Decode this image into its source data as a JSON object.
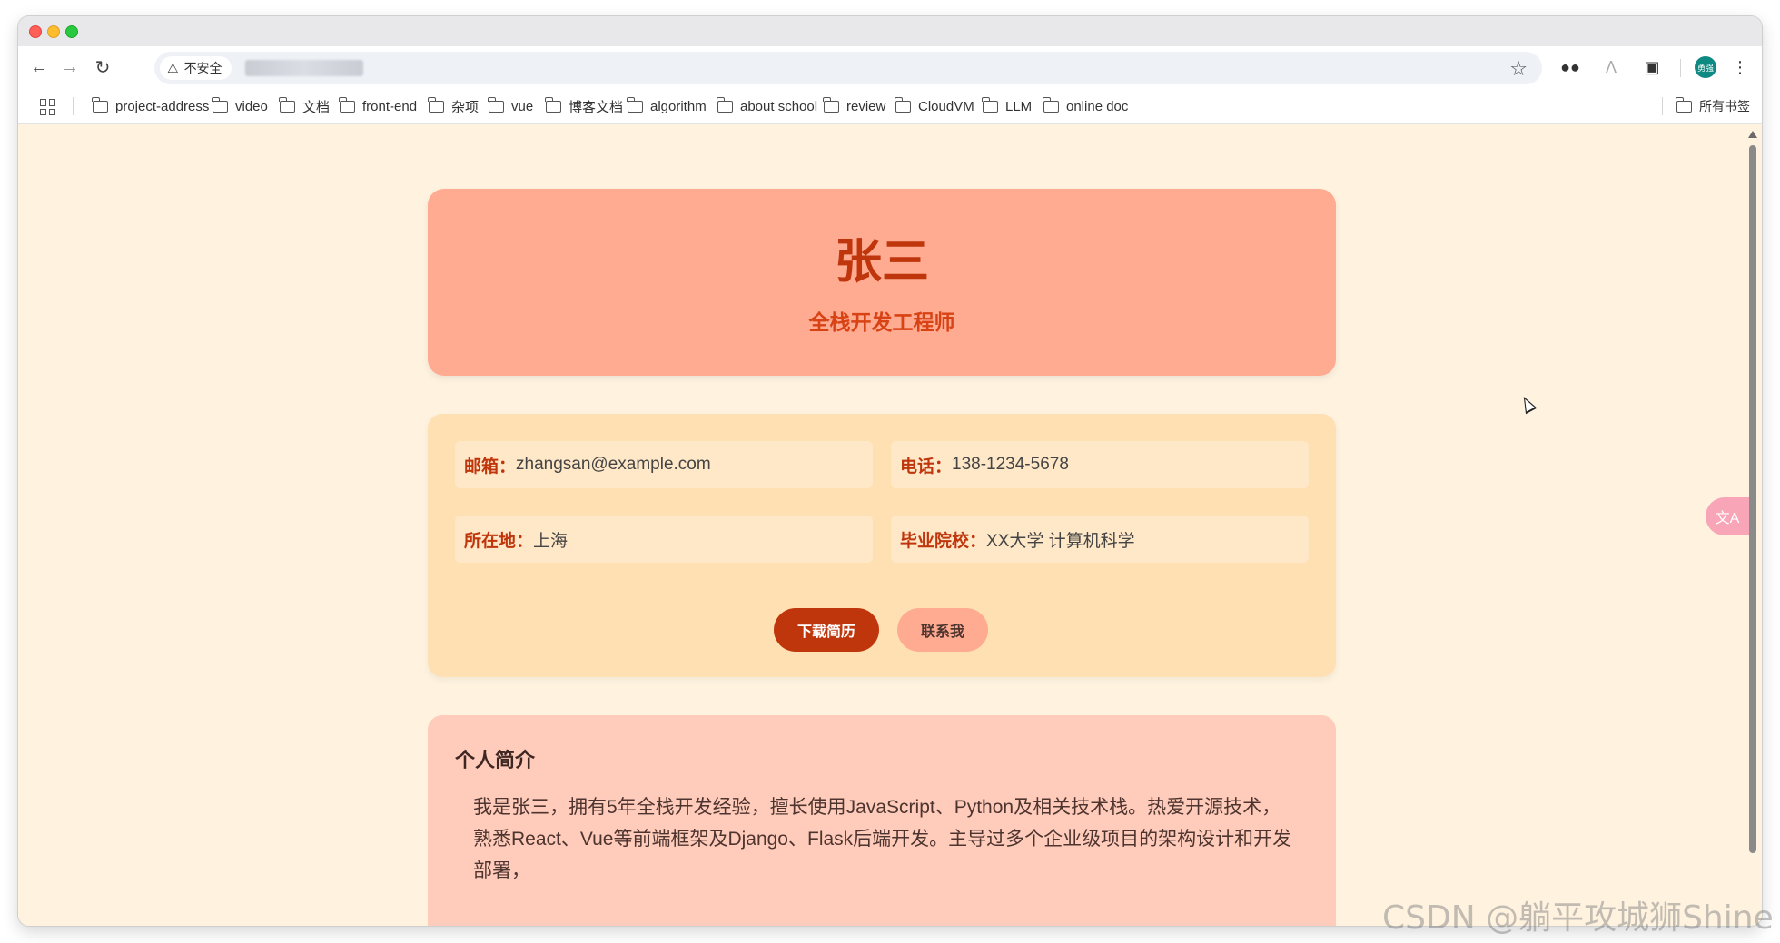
{
  "browser": {
    "security_label": "不安全",
    "profile_initials": "勇强",
    "bookmarks": [
      "project-address",
      "video",
      "文档",
      "front-end",
      "杂项",
      "vue",
      "博客文档",
      "algorithm",
      "about school",
      "review",
      "CloudVM",
      "LLM",
      "online doc"
    ],
    "all_bookmarks_label": "所有书签"
  },
  "resume": {
    "name": "张三",
    "title": "全栈开发工程师",
    "info": [
      {
        "label": "邮箱：",
        "value": "zhangsan@example.com"
      },
      {
        "label": "电话：",
        "value": "138-1234-5678"
      },
      {
        "label": "所在地：",
        "value": "上海"
      },
      {
        "label": "毕业院校：",
        "value": "XX大学 计算机科学"
      }
    ],
    "download_button": "下载简历",
    "contact_button": "联系我",
    "intro_heading": "个人简介",
    "intro_text": "我是张三，拥有5年全栈开发经验，擅长使用JavaScript、Python及相关技术栈。热爱开源技术，熟悉React、Vue等前端框架及Django、Flask后端开发。主导过多个企业级项目的架构设计和开发部署，"
  },
  "overlay": {
    "translate_label": "文A",
    "watermark": "CSDN @躺平攻城狮Shine"
  },
  "colors": {
    "page_bg": "#fff3e0",
    "header_card": "#ffab91",
    "info_card": "#ffe0b2",
    "intro_card": "#ffccbc",
    "accent": "#bf360c"
  }
}
